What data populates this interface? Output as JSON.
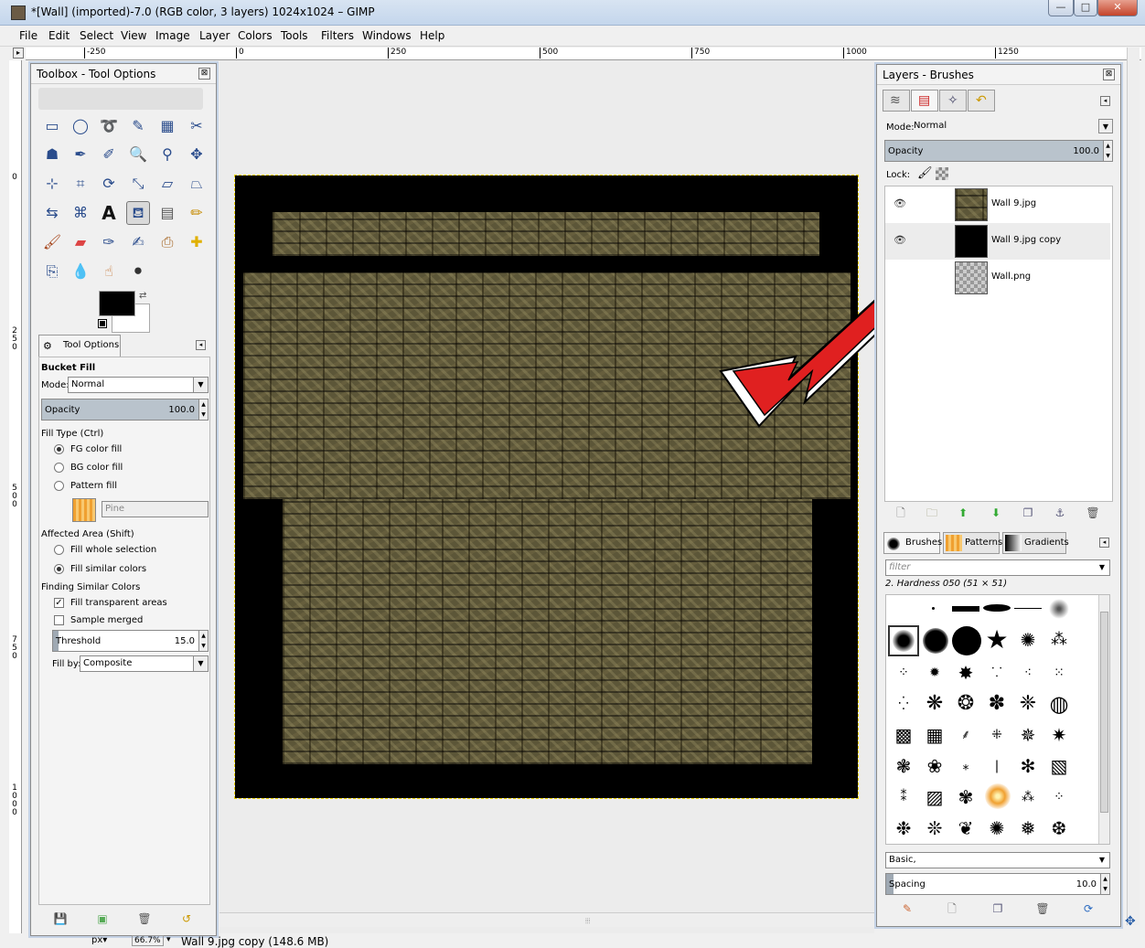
{
  "window": {
    "title": "*[Wall] (imported)-7.0 (RGB color, 3 layers) 1024x1024 – GIMP",
    "min": "—",
    "max": "□",
    "close": "✕"
  },
  "menu": [
    "File",
    "Edit",
    "Select",
    "View",
    "Image",
    "Layer",
    "Colors",
    "Tools",
    "Filters",
    "Windows",
    "Help"
  ],
  "ruler_top": [
    "-250",
    "0",
    "250",
    "500",
    "750",
    "1000",
    "1250"
  ],
  "ruler_left": [
    "0",
    "250",
    "500",
    "750",
    "1000"
  ],
  "toolbox": {
    "title": "Toolbox - Tool Options",
    "close": "⊠"
  },
  "tool_options": {
    "tab_label": "Tool Options",
    "tool_name": "Bucket Fill",
    "mode_label": "Mode:",
    "mode_value": "Normal",
    "opacity_label": "Opacity",
    "opacity_value": "100.0",
    "fill_type_label": "Fill Type  (Ctrl)",
    "fill_fg": "FG color fill",
    "fill_bg": "BG color fill",
    "fill_pattern": "Pattern fill",
    "pattern_name": "Pine",
    "affected_label": "Affected Area  (Shift)",
    "affected_whole": "Fill whole selection",
    "affected_similar": "Fill similar colors",
    "finding_label": "Finding Similar Colors",
    "fill_transparent": "Fill transparent areas",
    "sample_merged": "Sample merged",
    "threshold_label": "Threshold",
    "threshold_value": "15.0",
    "fill_by_label": "Fill by:",
    "fill_by_value": "Composite"
  },
  "layers": {
    "title": "Layers - Brushes",
    "mode_label": "Mode:",
    "mode_value": "Normal",
    "opacity_label": "Opacity",
    "opacity_value": "100.0",
    "lock_label": "Lock:",
    "items": [
      {
        "name": "Wall 9.jpg"
      },
      {
        "name": "Wall 9.jpg copy"
      },
      {
        "name": "Wall.png"
      }
    ]
  },
  "brushes": {
    "tabs": [
      "Brushes",
      "Patterns",
      "Gradients"
    ],
    "filter_placeholder": "filter",
    "current": "2. Hardness 050 (51 × 51)",
    "tag_value": "Basic,",
    "spacing_label": "Spacing",
    "spacing_value": "10.0"
  },
  "status": {
    "unit": "px▾",
    "zoom": "66.7%",
    "info": "Wall 9.jpg copy (148.6 MB)"
  },
  "colors": {
    "fg": "#000000",
    "bg": "#ffffff",
    "stone": "#5c5638",
    "accent_red": "#e02020"
  }
}
